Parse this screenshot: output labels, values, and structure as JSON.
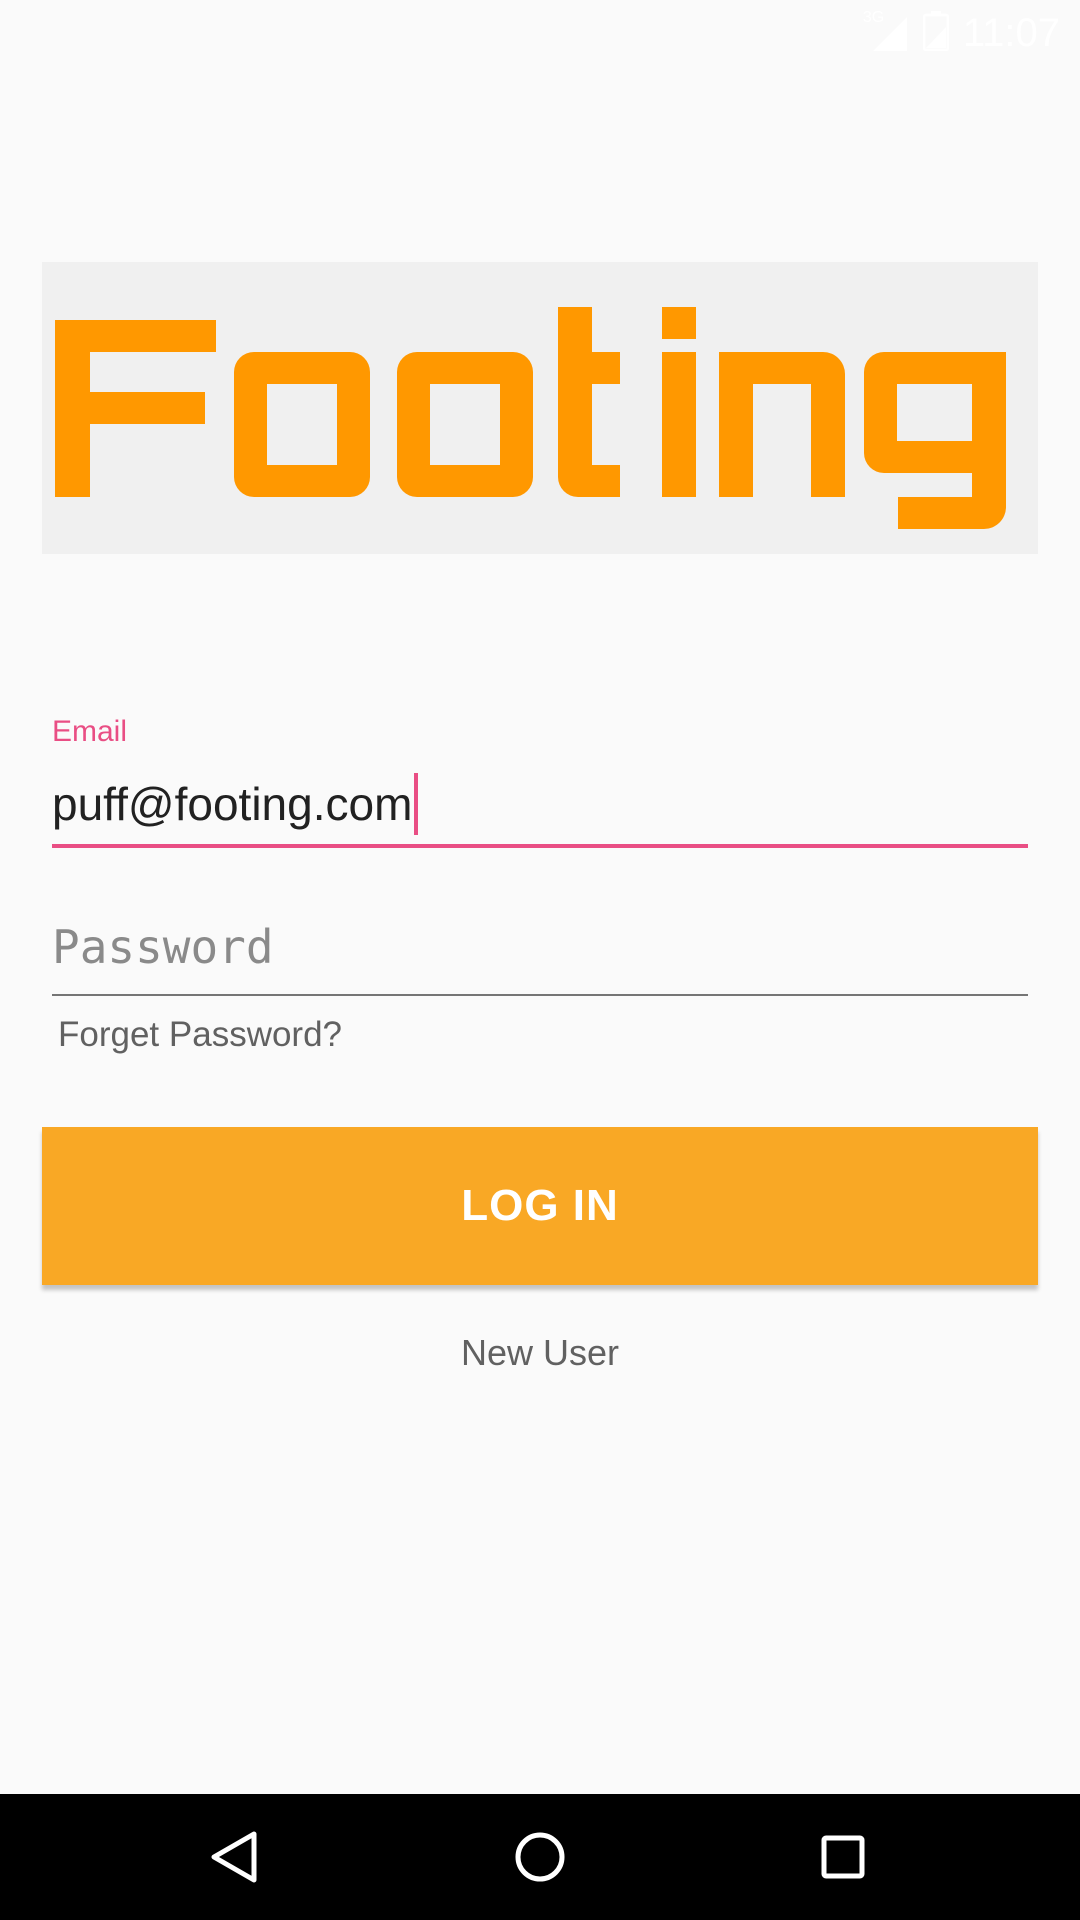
{
  "status_bar": {
    "network_label": "3G",
    "time": "11:07",
    "icons": [
      "signal-icon",
      "battery-icon"
    ]
  },
  "logo": {
    "text": "Footing",
    "color": "#ff9800",
    "background": "#f0f0f0"
  },
  "email": {
    "label": "Email",
    "value": "puff@footing.com",
    "accent_color": "#e94e84"
  },
  "password": {
    "placeholder": "Password",
    "value": ""
  },
  "forgot_password": {
    "label": "Forget Password?"
  },
  "login_button": {
    "label": "LOG IN",
    "color": "#f9a825"
  },
  "new_user": {
    "label": "New User"
  },
  "nav_bar": {
    "buttons": [
      "back-icon",
      "home-icon",
      "recents-icon"
    ]
  }
}
